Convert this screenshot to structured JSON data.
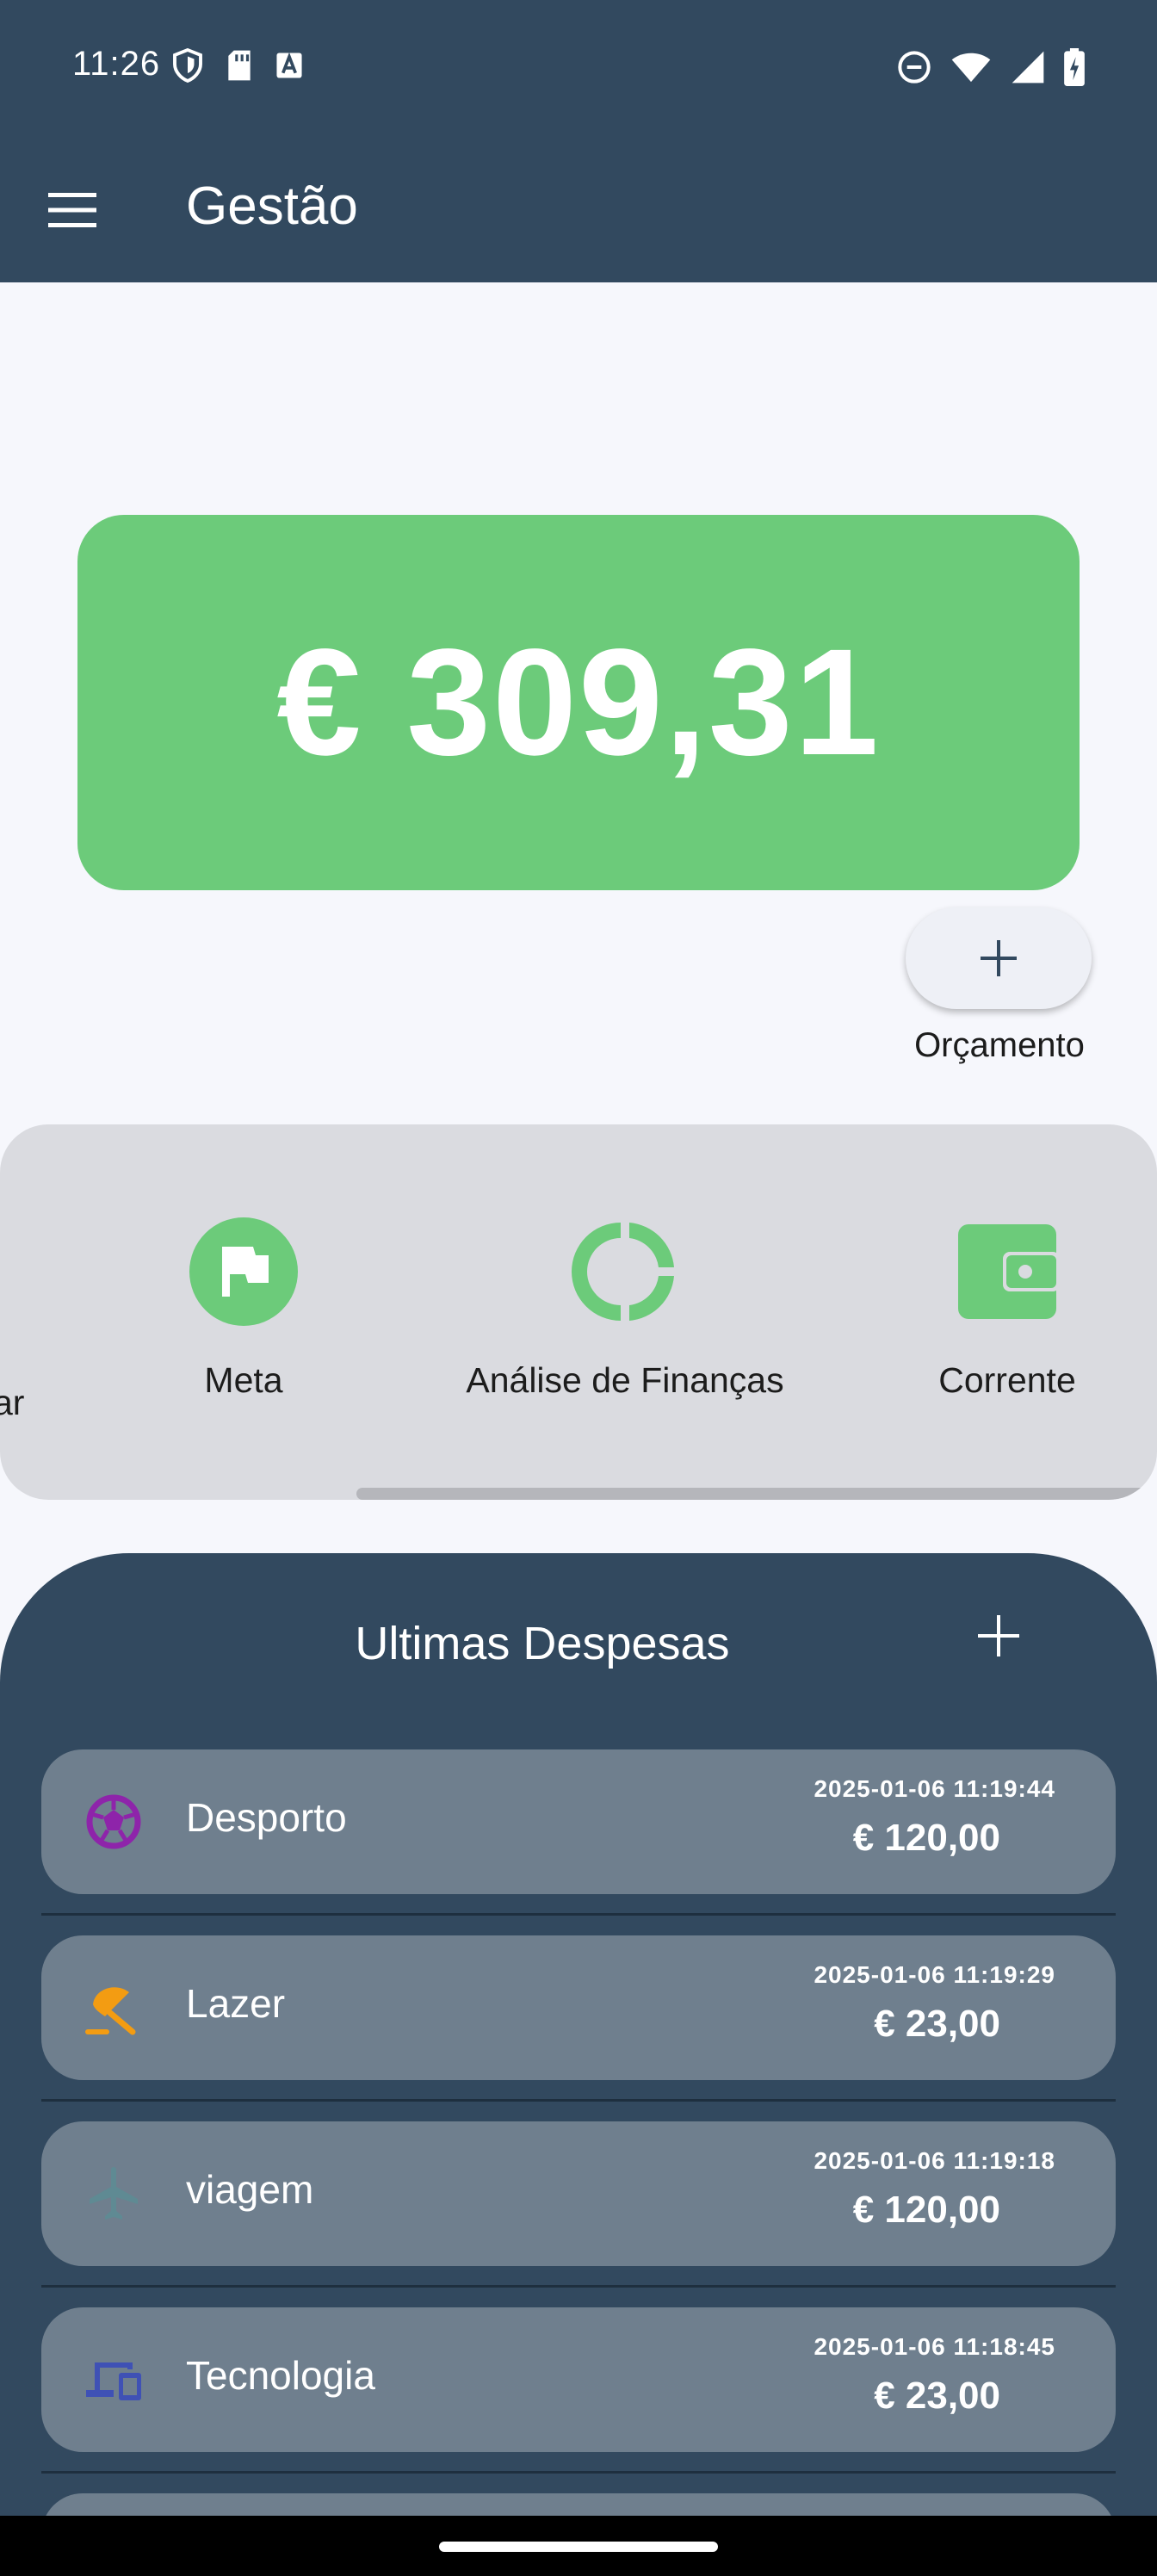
{
  "status_bar": {
    "time": "11:26"
  },
  "app_bar": {
    "title": "Gestão"
  },
  "balance": {
    "value": "€ 309,31",
    "color": "#6ccb7a"
  },
  "budget_button": {
    "label": "Orçamento"
  },
  "shortcuts": {
    "partial_label": "ar",
    "items": [
      {
        "label": "Meta",
        "icon": "flag-icon"
      },
      {
        "label": "Análise de Finanças",
        "icon": "donut-chart-icon"
      },
      {
        "label": "Corrente",
        "icon": "wallet-icon"
      }
    ]
  },
  "expenses": {
    "title": "Ultimas Despesas",
    "items": [
      {
        "name": "Desporto",
        "date": "2025-01-06 11:19:44",
        "amount": "€ 120,00",
        "icon": "soccer-ball-icon",
        "icon_color": "#8e24aa"
      },
      {
        "name": "Lazer",
        "date": "2025-01-06 11:19:29",
        "amount": "€ 23,00",
        "icon": "beach-umbrella-icon",
        "icon_color": "#f39c12"
      },
      {
        "name": "viagem",
        "date": "2025-01-06 11:19:18",
        "amount": "€ 120,00",
        "icon": "airplane-icon",
        "icon_color": "#5f8a93"
      },
      {
        "name": "Tecnologia",
        "date": "2025-01-06 11:18:45",
        "amount": "€ 23,00",
        "icon": "devices-icon",
        "icon_color": "#3f51b5"
      }
    ]
  },
  "colors": {
    "header": "#32495f",
    "panel": "#dadbe0",
    "row": "#6f7f8e",
    "accent_green": "#6ccb7a"
  }
}
